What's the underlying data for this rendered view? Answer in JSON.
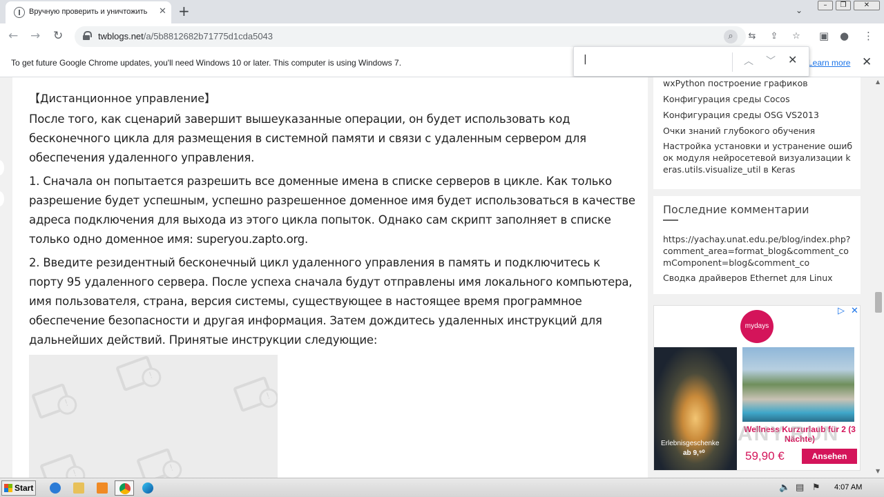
{
  "browser": {
    "tab_title": "Вручную проверить и уничтожить",
    "new_tab_icon": "+",
    "url_host": "twblogs.net",
    "url_path": "/a/5b8812682b71775d1cda5043",
    "window_controls": [
      "minimize",
      "restore",
      "close"
    ]
  },
  "infobar": {
    "message": "To get future Google Chrome updates, you'll need Windows 10 or later. This computer is using Windows 7.",
    "learn_more": "Learn more"
  },
  "findbar": {
    "value": "|"
  },
  "article": {
    "heading": "【Дистанционное управление】",
    "paragraphs": [
      "После того, как сценарий завершит вышеуказанные операции, он будет использовать код бесконечного цикла для размещения в системной памяти и связи с удаленным сервером для обеспечения удаленного управления.",
      "1. Сначала он попытается разрешить все доменные имена в списке серверов в цикле. Как только разрешение будет успешным, успешно разрешенное доменное имя будет использоваться в качестве адреса подключения для выхода из этого цикла попыток. Однако сам скрипт заполняет в списке только одно доменное имя: superyou.zapto.org.",
      "2. Введите резидентный бесконечный цикл удаленного управления в память и подключитесь к порту 95 удаленного сервера. После успеха сначала будут отправлены имя локального компьютера, имя пользователя, страна, версия системы, существующее в настоящее время программное обеспечение безопасности и другая информация. Затем дождитесь удаленных инструкций для дальнейших действий. Принятые инструкции следующие:"
    ]
  },
  "sidebar": {
    "related_links": [
      "wxPython построение графиков",
      "Конфигурация среды Cocos",
      "Конфигурация среды OSG VS2013",
      "Очки знаний глубокого обучения",
      "Настройка установки и устранение ошибок модуля нейросетевой визуализации keras.utils.visualize_util в Keras"
    ],
    "recent_comments_title": "Последние комментарии",
    "recent_comments": [
      "https://yachay.unat.edu.pe/blog/index.php?comment_area=format_blog&comment_comComponent=blog&comment_co",
      "Сводка драйверов Ethernet для Linux"
    ]
  },
  "ad": {
    "brand": "mydays",
    "caption": "Erlebnisgeschenke",
    "from_price": "ab 9,⁹⁰",
    "offer": "Wellness Kurzurlaub für 2 (3 Nächte)",
    "price": "59,90 €",
    "cta": "Ansehen"
  },
  "watermark": "ANY.RUN",
  "taskbar": {
    "start_label": "Start",
    "clock": "4:07 AM"
  },
  "colors": {
    "accent": "#1a73e8",
    "ad_brand": "#d4145a",
    "text": "#222222"
  }
}
